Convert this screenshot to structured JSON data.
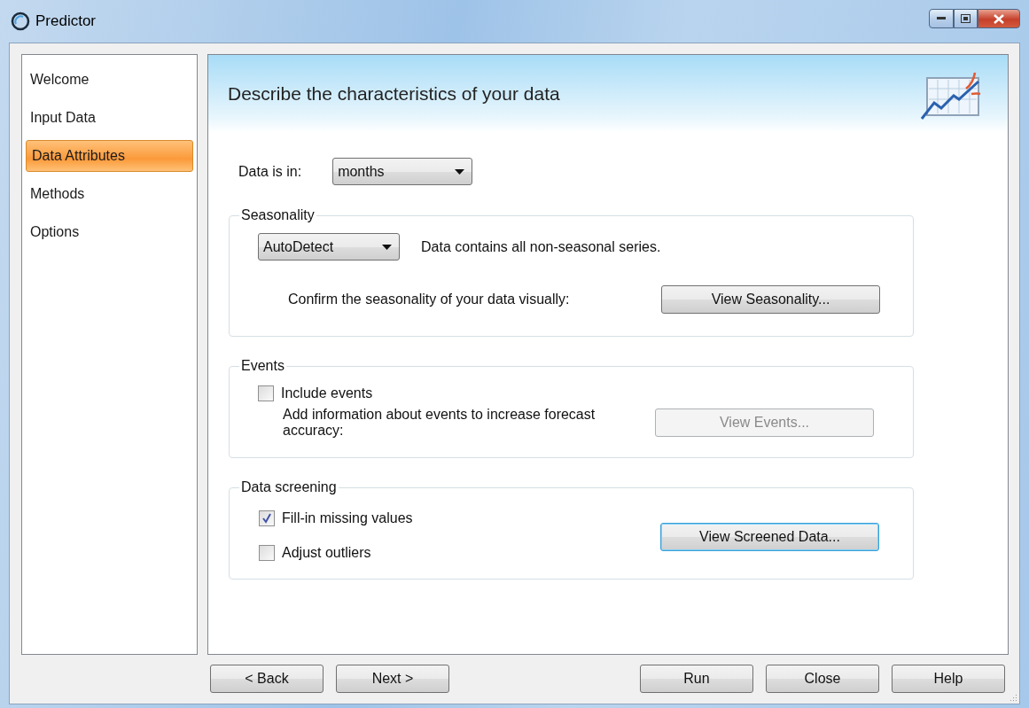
{
  "window": {
    "title": "Predictor"
  },
  "sidebar": {
    "items": [
      {
        "label": "Welcome",
        "selected": false
      },
      {
        "label": "Input Data",
        "selected": false
      },
      {
        "label": "Data Attributes",
        "selected": true
      },
      {
        "label": "Methods",
        "selected": false
      },
      {
        "label": "Options",
        "selected": false
      }
    ]
  },
  "header": {
    "title": "Describe the characteristics of your data"
  },
  "data_is_in": {
    "label": "Data is in:",
    "value": "months"
  },
  "seasonality": {
    "legend": "Seasonality",
    "value": "AutoDetect",
    "message": "Data contains all non-seasonal series.",
    "confirm_text": "Confirm the seasonality of your data visually:",
    "button": {
      "label": "View Seasonality...",
      "disabled": false,
      "focused": false
    }
  },
  "events": {
    "legend": "Events",
    "checkbox": {
      "label": "Include events",
      "checked": false
    },
    "text": "Add information about events to increase forecast accuracy:",
    "button": {
      "label": "View Events...",
      "disabled": true,
      "focused": false
    }
  },
  "data_screening": {
    "legend": "Data screening",
    "checkboxes": [
      {
        "label": "Fill-in missing values",
        "checked": true
      },
      {
        "label": "Adjust outliers",
        "checked": false
      }
    ],
    "button": {
      "label": "View Screened Data...",
      "disabled": false,
      "focused": true
    }
  },
  "footer": {
    "nav_buttons": [
      "< Back",
      "Next >"
    ],
    "action_buttons": [
      "Run",
      "Close",
      "Help"
    ]
  }
}
